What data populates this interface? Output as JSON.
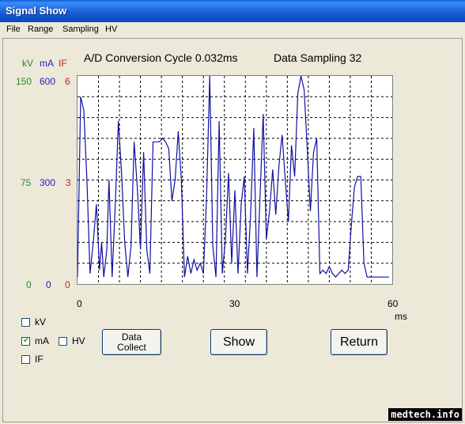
{
  "window": {
    "title": "Signal Show"
  },
  "menu": [
    "File",
    "Range",
    "Sampling",
    "HV"
  ],
  "header": {
    "conversion": "A/D Conversion Cycle 0.032ms",
    "sampling": "Data Sampling 32"
  },
  "axes": {
    "units": {
      "kv": "kV",
      "ma": "mA",
      "if": "IF"
    },
    "max": {
      "kv": "150",
      "ma": "600",
      "if": "6"
    },
    "mid": {
      "kv": "75",
      "ma": "300",
      "if": "3"
    },
    "min": {
      "kv": "0",
      "ma": "0",
      "if": "0"
    },
    "x_ticks": [
      "0",
      "30",
      "60"
    ],
    "x_unit": "ms"
  },
  "checkboxes": {
    "kv": {
      "label": "kV",
      "checked": false
    },
    "ma": {
      "label": "mA",
      "checked": true
    },
    "hv": {
      "label": "HV",
      "checked": false
    },
    "if": {
      "label": "IF",
      "checked": false
    }
  },
  "buttons": {
    "data_collect": "Data Collect",
    "show": "Show",
    "return": "Return"
  },
  "watermark": "medtech.info",
  "colors": {
    "kv": "#2a8a2a",
    "ma": "#2020c8",
    "if": "#c82020",
    "trace": "#1010a0"
  },
  "chart_data": {
    "type": "line",
    "xlim": [
      0,
      60
    ],
    "ylim": [
      0,
      600
    ],
    "grid": true,
    "xlabel": "ms",
    "series": [
      {
        "name": "mA",
        "x": [
          0,
          0.6,
          1.2,
          1.8,
          2.4,
          3.0,
          3.6,
          4.2,
          4.6,
          5.0,
          5.6,
          6.0,
          6.6,
          7.2,
          7.8,
          8.4,
          9.0,
          9.6,
          10.2,
          10.8,
          11.4,
          12.0,
          12.6,
          13.2,
          13.8,
          14.4,
          15.0,
          15.6,
          16.2,
          16.8,
          17.4,
          18.0,
          18.6,
          19.2,
          19.8,
          20.4,
          21.0,
          21.6,
          22.2,
          22.8,
          23.4,
          24.0,
          24.6,
          25.2,
          25.8,
          26.4,
          27.0,
          27.6,
          28.2,
          28.8,
          29.4,
          30.0,
          30.6,
          31.2,
          31.8,
          32.4,
          33.0,
          33.6,
          34.2,
          34.8,
          35.4,
          36.0,
          36.6,
          37.2,
          37.8,
          38.4,
          39.0,
          39.6,
          40.2,
          40.8,
          41.4,
          42.0,
          42.6,
          43.2,
          43.8,
          44.4,
          45.0,
          45.6,
          46.2,
          46.8,
          47.4,
          48.0,
          48.6,
          49.2,
          49.8,
          50.4,
          51.0,
          51.6,
          52.2,
          52.8,
          53.4,
          54.0,
          54.6,
          55.2,
          55.8,
          56.4,
          57.0,
          57.6,
          58.2,
          58.8,
          59.4
        ],
        "values": [
          20,
          540,
          500,
          300,
          30,
          120,
          230,
          40,
          120,
          20,
          100,
          300,
          20,
          230,
          470,
          320,
          120,
          20,
          110,
          410,
          280,
          100,
          380,
          100,
          30,
          410,
          410,
          410,
          420,
          410,
          390,
          240,
          300,
          440,
          300,
          20,
          80,
          30,
          70,
          40,
          60,
          30,
          250,
          600,
          110,
          20,
          470,
          30,
          130,
          320,
          60,
          270,
          30,
          230,
          310,
          30,
          200,
          450,
          20,
          250,
          490,
          130,
          210,
          330,
          200,
          340,
          430,
          300,
          180,
          400,
          310,
          550,
          600,
          560,
          390,
          210,
          380,
          420,
          30,
          40,
          30,
          50,
          30,
          20,
          30,
          40,
          30,
          40,
          170,
          280,
          310,
          310,
          60,
          20,
          20,
          20,
          20,
          20,
          20,
          20,
          20
        ]
      }
    ]
  }
}
